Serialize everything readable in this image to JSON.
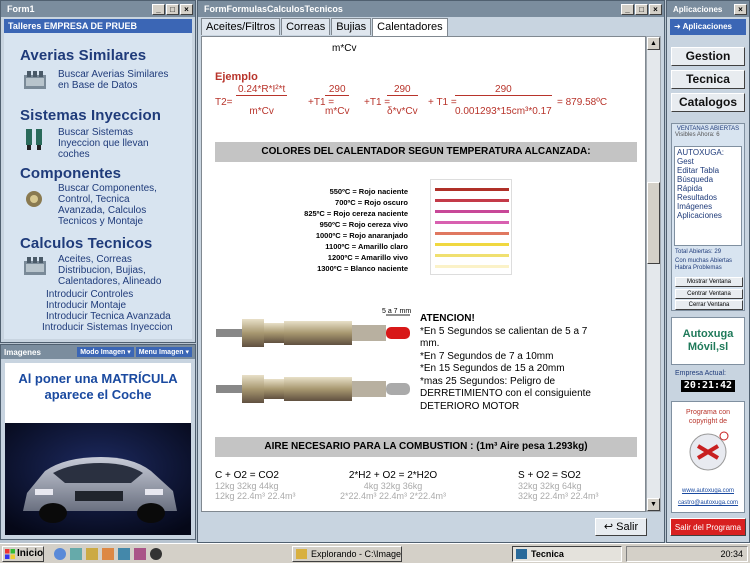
{
  "form1": {
    "title": "Form1",
    "header": "Talleres EMPRESA DE PRUEB",
    "sections": [
      {
        "title": "Averias Similares",
        "lines": [
          "Buscar Averias Similares",
          "en Base de Datos"
        ]
      },
      {
        "title": "Sistemas Inyeccion",
        "lines": [
          "Buscar Sistemas",
          "Inyeccion que llevan",
          "coches"
        ]
      },
      {
        "title": "Componentes",
        "lines": [
          "Buscar Componentes,",
          "Control, Tecnica",
          "Avanzada, Calculos",
          "Tecnicos y Montaje"
        ]
      },
      {
        "title": "Calculos Tecnicos",
        "lines": [
          "Aceites, Correas",
          "Distribucion, Bujias,",
          "Calentadores, Alineado"
        ]
      }
    ],
    "links": [
      "Introducir Controles",
      "Introducir Montaje",
      "Introducir Tecnica Avanzada",
      "Introducir Sistemas Inyeccion"
    ]
  },
  "imagenes": {
    "title": "Imagenes",
    "menu1": "Modo Imagen",
    "menu2": "Menu Imagen",
    "caption": "Al poner una MATRÍCULA aparece el Coche"
  },
  "main": {
    "title": "FormFormulasCalculosTecnicos",
    "tabs": [
      "Aceites/Filtros",
      "Correas",
      "Bujias",
      "Calentadores"
    ],
    "active_tab": "Calentadores",
    "top_formula": "m*Cv",
    "ejemplo": "Ejemplo",
    "formula": {
      "t2": "T2=",
      "f1_num": "0.24*R*I²*t",
      "f1_den": "m*Cv",
      "plus_t1": "+T1 =",
      "f2_num": "290",
      "f2_den": "m*Cv",
      "f3_num": "290",
      "f3_den": "δ*v*Cv",
      "plus_t1b": "+ T1 =",
      "f4_num": "290",
      "f4_den": "0.001293*15cm³*0.17",
      "result": "= 879.58ºC"
    },
    "colores_header": "COLORES DEL CALENTADOR SEGUN TEMPERATURA ALCANZADA:",
    "temperatures": [
      "550ºC = Rojo naciente",
      "700ºC = Rojo oscuro",
      "825ºC = Rojo cereza naciente",
      "950ºC = Rojo cereza vivo",
      "1000ºC = Rojo anaranjado",
      "1100ºC = Amarillo claro",
      "1200ºC = Amarillo vivo",
      "1300ºC = Blanco naciente"
    ],
    "stripe_colors": [
      "#b03028",
      "#c43a48",
      "#c84898",
      "#d860b0",
      "#e07860",
      "#f0d840",
      "#f0e070",
      "#fbf2c8"
    ],
    "plug_dimension": "5 a 7 mm",
    "atencion_title": "ATENCION!",
    "atencion_lines": [
      "*En 5 Segundos se calientan de 5 a 7",
      "mm.",
      "*En 7 Segundos de 7 a 10mm",
      "*En 15 Segundos de 15 a 20mm",
      "*mas 25 Segundos: Peligro de",
      "DERRETIMIENTO con el consiguiente",
      "DETERIORO MOTOR"
    ],
    "aire_header": "AIRE NECESARIO PARA LA COMBUSTION : (1m³ Aire pesa 1.293kg)",
    "combustion": {
      "c_eq": "C  +  O2 = CO2",
      "c_kg": "12kg  32kg  44kg",
      "c_m3": "12kg 22.4m³ 22.4m³",
      "h_eq": "2*H2 + O2 = 2*H2O",
      "h_kg": "4kg    32kg    36kg",
      "h_m3": "2*22.4m³ 22.4m³ 2*22.4m³",
      "s_eq": "S  +  O2 = SO2",
      "s_kg": "32kg   32kg   64kg",
      "s_m3": "32kg 22.4m³ 22.4m³"
    },
    "salir": "Salir"
  },
  "right": {
    "title": "Aplicaciones",
    "aplicaciones_btn": "Aplicaciones",
    "buttons": [
      "Gestion",
      "Tecnica",
      "Catalogos"
    ],
    "ventanas_title": "VENTANAS ABIERTAS",
    "visibles": "Visibles Ahora: 6",
    "window_list": [
      "AUTOXUGA: Gest",
      "Editar Tabla",
      "Búsqueda Rápida",
      "Resultados",
      "Imágenes",
      "Aplicaciones"
    ],
    "total": "Total Abiertas: 29",
    "warning": "Con muchas Abiertas Habra Problemas",
    "small_buttons": [
      "Mostrar Ventana",
      "Centrar Ventana",
      "Cerrar Ventana"
    ],
    "brand_line1": "Autoxuga",
    "brand_line2": "Móvil,sl",
    "empresa_label": "Empresa Actual:",
    "clock": "20:21:42",
    "copyright_line1": "Programa con",
    "copyright_line2": "copyright de",
    "url1": "www.autoxuga.com",
    "url2": "castro@autoxuga.com",
    "salir_programa": "Salir del Programa"
  },
  "taskbar": {
    "start": "Inicio",
    "task1": "Explorando - C:\\Imagen...",
    "task2": "Tecnica",
    "time": "20:34"
  }
}
